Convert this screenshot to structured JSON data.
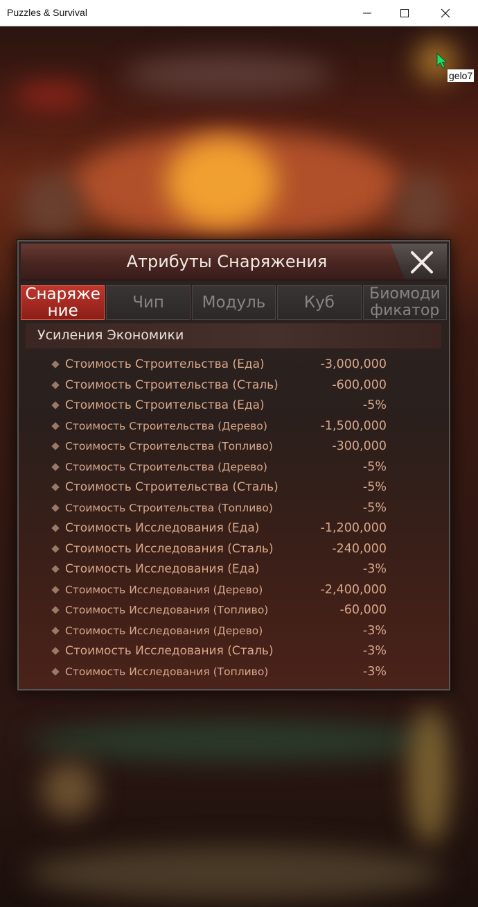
{
  "window": {
    "title": "Puzzles & Survival"
  },
  "overlay": {
    "user_tag": "gelo7"
  },
  "modal": {
    "title": "Атрибуты Снаряжения",
    "tabs": [
      {
        "label": "Снаряже ние",
        "active": true
      },
      {
        "label": "Чип",
        "active": false
      },
      {
        "label": "Модуль",
        "active": false
      },
      {
        "label": "Куб",
        "active": false
      },
      {
        "label": "Биомоди фикатор",
        "active": false
      }
    ],
    "section_title": "Усиления Экономики",
    "rows": [
      {
        "label": "Стоимость Строительства (Еда)",
        "value": "-3,000,000"
      },
      {
        "label": "Стоимость Строительства (Сталь)",
        "value": "-600,000"
      },
      {
        "label": "Стоимость Строительства (Еда)",
        "value": "-5%"
      },
      {
        "label": "Стоимость Строительства (Дерево)",
        "value": "-1,500,000"
      },
      {
        "label": "Стоимость Строительства (Топливо)",
        "value": "-300,000"
      },
      {
        "label": "Стоимость Строительства (Дерево)",
        "value": "-5%"
      },
      {
        "label": "Стоимость Строительства (Сталь)",
        "value": "-5%"
      },
      {
        "label": "Стоимость Строительства (Топливо)",
        "value": "-5%"
      },
      {
        "label": "Стоимость Исследования (Еда)",
        "value": "-1,200,000"
      },
      {
        "label": "Стоимость Исследования (Сталь)",
        "value": "-240,000"
      },
      {
        "label": "Стоимость Исследования (Еда)",
        "value": "-3%"
      },
      {
        "label": "Стоимость Исследования (Дерево)",
        "value": "-2,400,000"
      },
      {
        "label": "Стоимость Исследования (Топливо)",
        "value": "-60,000"
      },
      {
        "label": "Стоимость Исследования (Дерево)",
        "value": "-3%"
      },
      {
        "label": "Стоимость Исследования (Сталь)",
        "value": "-3%"
      },
      {
        "label": "Стоимость Исследования (Топливо)",
        "value": "-3%"
      }
    ]
  },
  "colors": {
    "active_tab": "#c0362c",
    "row_text": "#d9a78a",
    "cursor": "#22dd66"
  }
}
